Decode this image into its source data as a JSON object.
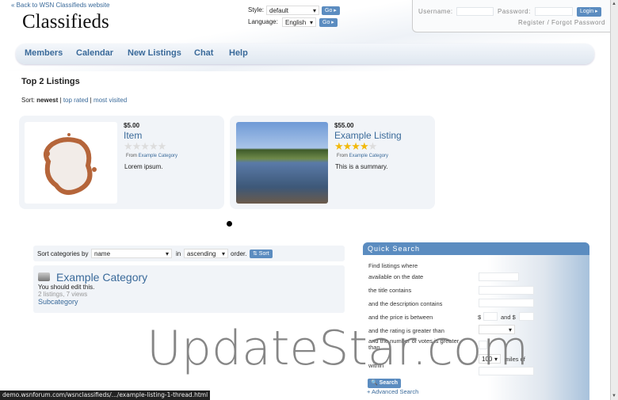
{
  "header": {
    "back_link": "« Back to WSN Classifieds website",
    "site_title": "Classifieds",
    "style_label": "Style:",
    "style_value": "default",
    "language_label": "Language:",
    "language_value": "English",
    "go_label": "Go ▸"
  },
  "login": {
    "username_label": "Username:",
    "password_label": "Password:",
    "login_button": "Login ▸",
    "register_link": "Register",
    "separator": "/",
    "forgot_link": "Forgot Password"
  },
  "nav": [
    "Members",
    "Calendar",
    "New Listings",
    "Chat",
    "Help"
  ],
  "listings_title": "Top 2 Listings",
  "sort": {
    "label": "Sort:",
    "current": "newest",
    "sep": "|",
    "options": [
      "top rated",
      "most visited"
    ]
  },
  "listings": [
    {
      "price": "$5.00",
      "title": "Item",
      "rating": 0,
      "from_label": "From",
      "category": "Example Category",
      "description": "Lorem ipsum."
    },
    {
      "price": "$55.00",
      "title": "Example Listing",
      "rating": 4,
      "from_label": "From",
      "category": "Example Category",
      "description": "This is a summary."
    }
  ],
  "category_sort": {
    "label": "Sort categories by",
    "field": "name",
    "in_label": "in",
    "direction": "ascending",
    "order_label": "order.",
    "button": "⇅ Sort"
  },
  "categories": [
    {
      "name": "Example Category",
      "description": "You should edit this.",
      "stats": "2 listings, 7 views",
      "subcategory": "Subcategory"
    }
  ],
  "quick_search": {
    "title": "Quick Search",
    "intro": "Find listings where",
    "date_label": "available on the date",
    "title_label": "the title contains",
    "desc_label": "and the description contains",
    "price_label": "and the price is between",
    "price_from": "$",
    "price_to": "and $",
    "rating_label": "and the rating is greater than",
    "votes_label": "and the number of votes is greater than",
    "within_label": "within",
    "miles_value": "100",
    "miles_label": "miles of",
    "search_button": "Search",
    "advanced_link": "+ Advanced Search"
  },
  "watermark": "UpdateStar.com",
  "status_bar": "demo.wsnforum.com/wsnclassifieds/.../example-listing-1-thread.html",
  "colors": {
    "accent": "#5b8cc0",
    "link": "#3a6a9a"
  }
}
